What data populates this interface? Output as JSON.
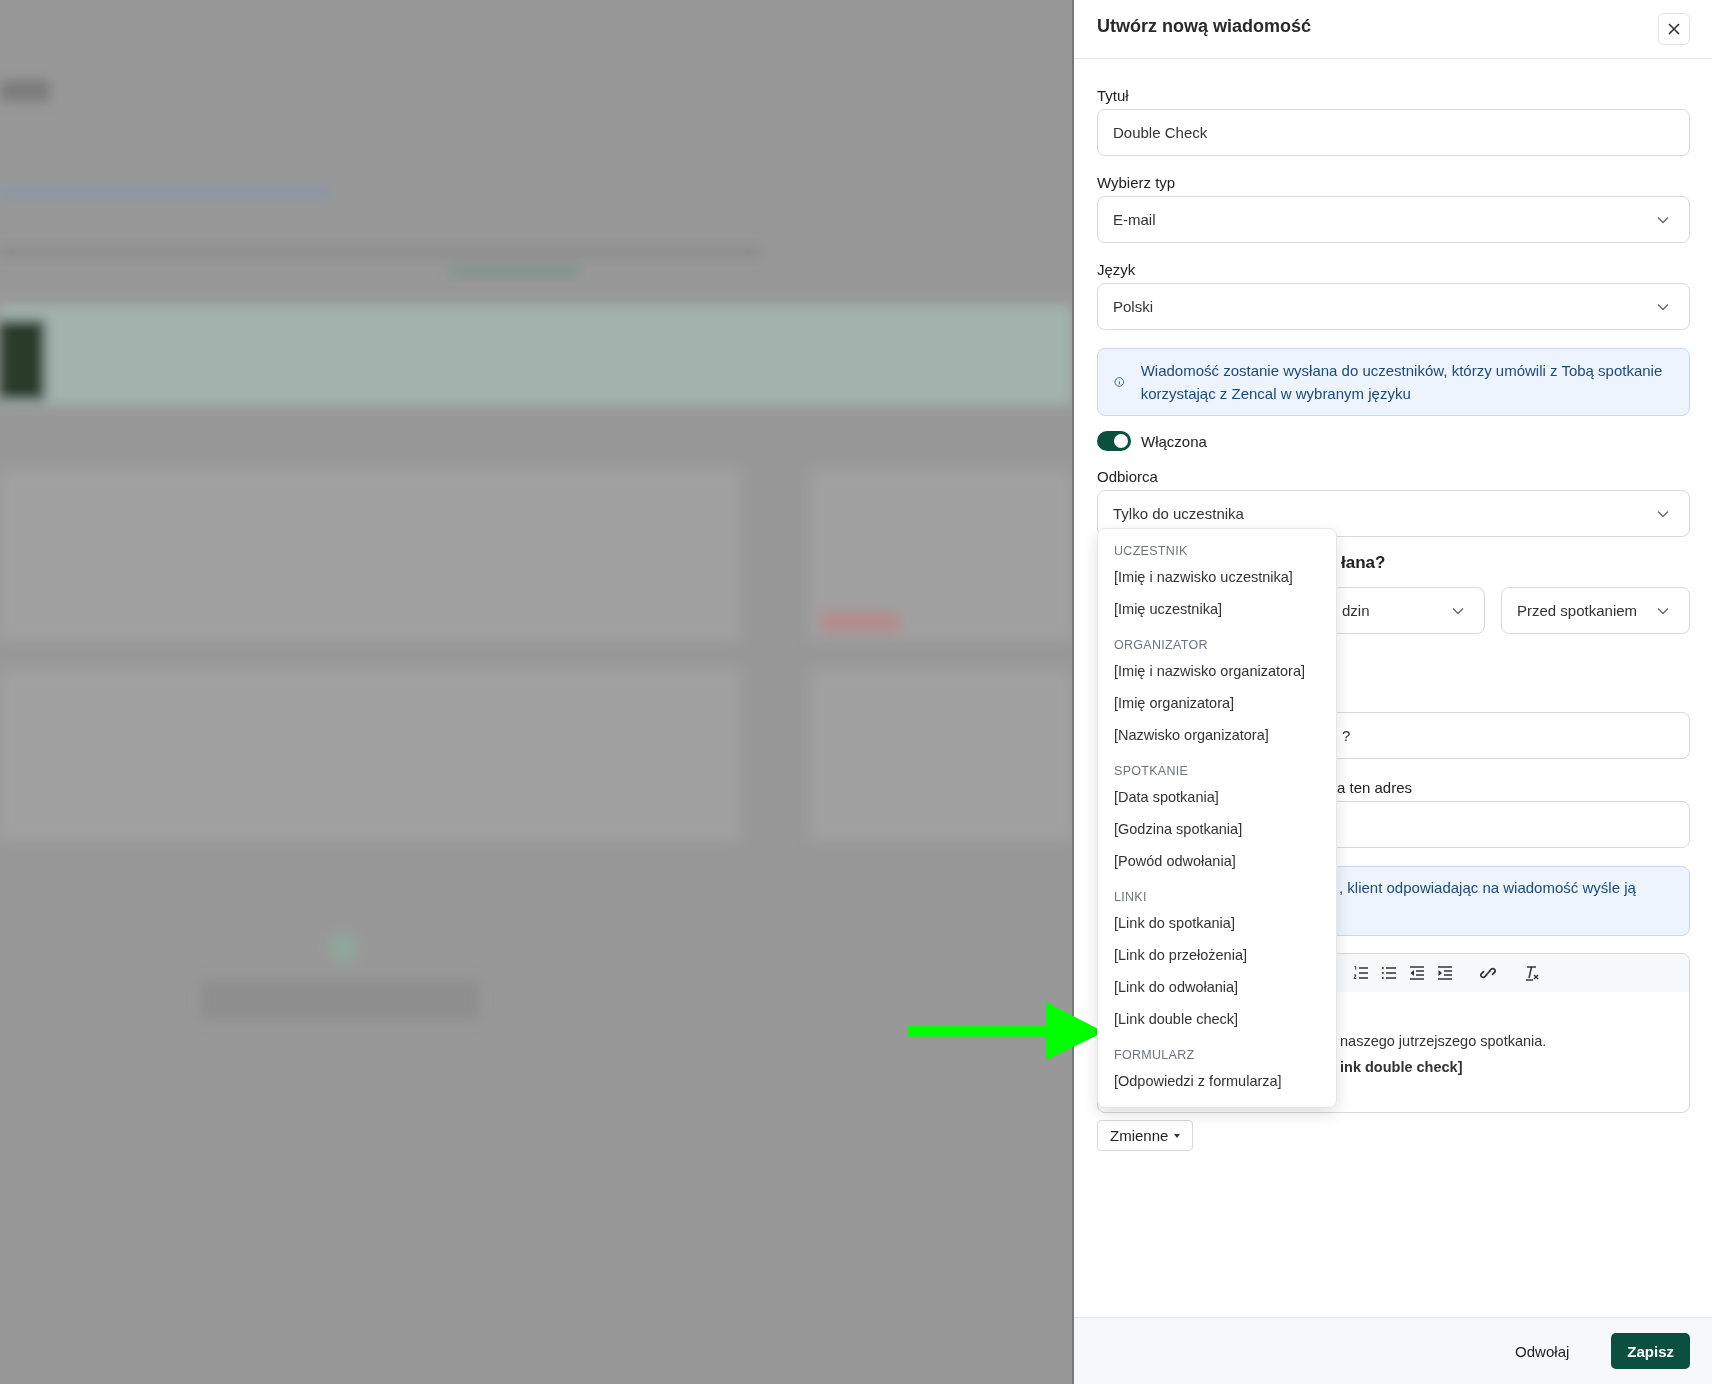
{
  "dialog": {
    "title": "Utwórz nową wiadomość"
  },
  "fields": [
    {
      "kind": "input",
      "label": "Tytuł",
      "value": "Double Check"
    },
    {
      "kind": "select",
      "label": "Wybierz typ",
      "value": "E-mail"
    },
    {
      "kind": "select",
      "label": "Język",
      "value": "Polski"
    }
  ],
  "notice": "Wiadomość zostanie wysłana do uczestników, którzy umówili z Tobą spotkanie korzystając z Zencal w wybranym języku",
  "toggle": {
    "label": "Włączona",
    "on": true
  },
  "recipient": {
    "label": "Odbiorca",
    "value": "Tylko do uczestnika"
  },
  "timing": {
    "heading": "łana?",
    "selects": [
      {
        "value": "dzin"
      },
      {
        "value": "Przed spotkaniem"
      }
    ]
  },
  "subject_field": {
    "value": "?"
  },
  "reply_field": {
    "label": "a ten adres"
  },
  "reply_notice": ", klient odpowiadając na wiadomość wyśle ją",
  "editor": {
    "lines": [
      {
        "text": "naszego jutrzejszego spotkania.",
        "bold": false
      },
      {
        "text": "ink double check]",
        "bold": true
      }
    ]
  },
  "variables_button": {
    "label": "Zmienne"
  },
  "variables_menu": {
    "groups": [
      {
        "heading": "UCZESTNIK",
        "items": [
          "[Imię i nazwisko uczestnika]",
          "[Imię uczestnika]"
        ]
      },
      {
        "heading": "ORGANIZATOR",
        "items": [
          "[Imię i nazwisko organizatora]",
          "[Imię organizatora]",
          "[Nazwisko organizatora]"
        ]
      },
      {
        "heading": "SPOTKANIE",
        "items": [
          "[Data spotkania]",
          "[Godzina spotkania]",
          "[Powód odwołania]"
        ]
      },
      {
        "heading": "LINKI",
        "items": [
          "[Link do spotkania]",
          "[Link do przełożenia]",
          "[Link do odwołania]",
          "[Link double check]"
        ]
      },
      {
        "heading": "FORMULARZ",
        "items": [
          "[Odpowiedzi z formularza]"
        ]
      }
    ]
  },
  "footer": {
    "buttons": [
      {
        "label": "Odwołaj",
        "kind": "secondary"
      },
      {
        "label": "Zapisz",
        "kind": "primary"
      }
    ]
  }
}
